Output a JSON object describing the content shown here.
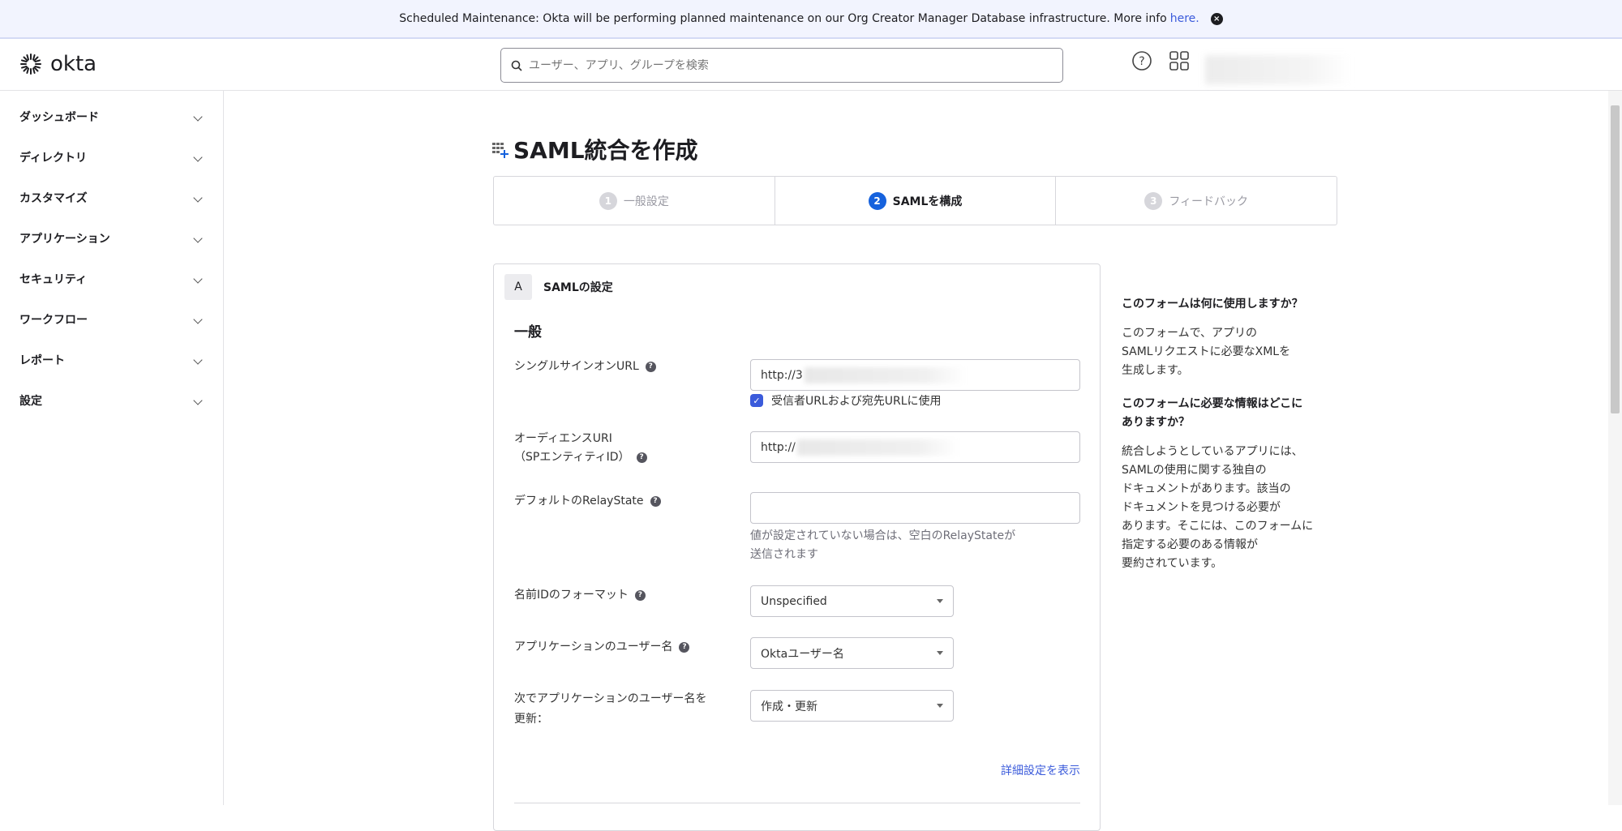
{
  "banner": {
    "text": "Scheduled Maintenance: Okta will be performing planned maintenance on our Org Creator Manager Database infrastructure. More info",
    "link": "here.",
    "close_icon": "close-circle-icon"
  },
  "header": {
    "logo": "okta",
    "search_placeholder": "ユーザー、アプリ、グループを検索",
    "help_icon": "help-circle-icon",
    "apps_icon": "grid-icon"
  },
  "sidebar": {
    "items": [
      {
        "label": "ダッシュボード"
      },
      {
        "label": "ディレクトリ"
      },
      {
        "label": "カスタマイズ"
      },
      {
        "label": "アプリケーション"
      },
      {
        "label": "セキュリティ"
      },
      {
        "label": "ワークフロー"
      },
      {
        "label": "レポート"
      },
      {
        "label": "設定"
      }
    ]
  },
  "page": {
    "title": "SAML統合を作成"
  },
  "steps": [
    {
      "num": "1",
      "label": "一般設定",
      "active": false
    },
    {
      "num": "2",
      "label": "SAMLを構成",
      "active": true
    },
    {
      "num": "3",
      "label": "フィードバック",
      "active": false
    }
  ],
  "form": {
    "section_badge": "A",
    "section_title": "SAMLの設定",
    "group_title": "一般",
    "sso_url": {
      "label": "シングルサインオンURL",
      "value": "http://3",
      "checkbox_label": "受信者URLおよび宛先URLに使用",
      "checked": true
    },
    "audience": {
      "label1": "オーディエンスURI",
      "label2": "（SPエンティティID）",
      "value": "http://"
    },
    "relay": {
      "label": "デフォルトのRelayState",
      "value": "",
      "help1": "値が設定されていない場合は、空白のRelayStateが",
      "help2": "送信されます"
    },
    "name_id": {
      "label": "名前IDのフォーマット",
      "value": "Unspecified"
    },
    "app_user": {
      "label": "アプリケーションのユーザー名",
      "value": "Oktaユーザー名"
    },
    "update": {
      "label1": "次でアプリケーションのユーザー名を",
      "label2": "更新：",
      "value": "作成・更新"
    },
    "advanced_link": "詳細設定を表示"
  },
  "sidepanel": {
    "q1": "このフォームは何に使用しますか？",
    "a1": [
      "このフォームで、アプリの",
      "SAMLリクエストに必要なXMLを",
      "生成します。"
    ],
    "q2": [
      "このフォームに必要な情報はどこに",
      "ありますか？"
    ],
    "a2": [
      "統合しようとしているアプリには、",
      "SAMLの使用に関する独自の",
      "ドキュメントがあります。該当の",
      "ドキュメントを見つける必要が",
      "あります。そこには、このフォームに",
      "指定する必要のある情報が",
      "要約されています。"
    ]
  },
  "colors": {
    "accent": "#1662dd",
    "banner_bg": "#f2f4fe",
    "link": "#3b5bdb"
  }
}
